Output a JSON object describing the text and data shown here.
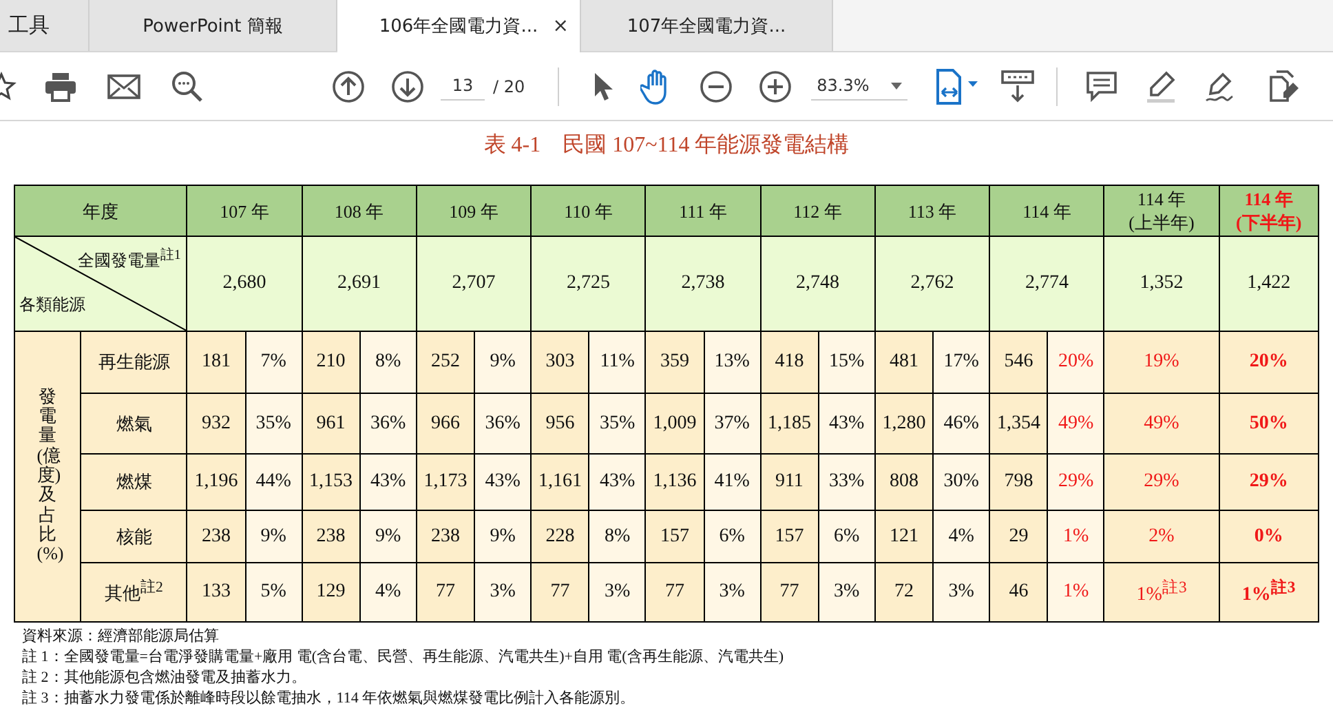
{
  "tabs": [
    {
      "label": "工具",
      "selected": false
    },
    {
      "label": "PowerPoint 簡報",
      "selected": false
    },
    {
      "label": "106年全國電力資...",
      "selected": true,
      "close": "×"
    },
    {
      "label": "107年全國電力資...",
      "selected": false
    }
  ],
  "toolbar": {
    "page": "13",
    "page_count": "/ 20",
    "zoom": "83.3%",
    "pointer_selected": false,
    "hand_selected": true
  },
  "document": {
    "title": "表 4-1　民國 107~114 年能源發電結構",
    "table": {
      "corner_header": "年度",
      "total_label": "全國發電量$^{註1}$",
      "category_label": "各類能源",
      "side_label": "發電量(億度)及占比(%)",
      "columns": [
        {
          "label": "107 年",
          "kind": "year",
          "header_red": false,
          "cells_red": false,
          "bold": false
        },
        {
          "label": "108 年",
          "kind": "year",
          "header_red": false,
          "cells_red": false,
          "bold": false
        },
        {
          "label": "109 年",
          "kind": "year",
          "header_red": false,
          "cells_red": false,
          "bold": false
        },
        {
          "label": "110 年",
          "kind": "year",
          "header_red": false,
          "cells_red": false,
          "bold": false
        },
        {
          "label": "111 年",
          "kind": "year",
          "header_red": false,
          "cells_red": false,
          "bold": false
        },
        {
          "label": "112 年",
          "kind": "year",
          "header_red": false,
          "cells_red": false,
          "bold": false
        },
        {
          "label": "113 年",
          "kind": "year",
          "header_red": false,
          "cells_red": false,
          "bold": false
        },
        {
          "label": "114 年",
          "kind": "year",
          "header_red": false,
          "cells_red": true,
          "bold": false
        },
        {
          "label": "114 年",
          "sublabel": "(上半年)",
          "kind": "half",
          "header_red": false,
          "cells_red": true,
          "bold": false
        },
        {
          "label": "114 年",
          "sublabel": "(下半年)",
          "kind": "half",
          "header_red": true,
          "cells_red": true,
          "bold": true
        }
      ],
      "totals": [
        "2,680",
        "2,691",
        "2,707",
        "2,725",
        "2,738",
        "2,748",
        "2,762",
        "2,774",
        "1,352",
        "1,422"
      ],
      "rows": [
        {
          "name": "再生能源",
          "cells": [
            {
              "value": "181",
              "share": "7%"
            },
            {
              "value": "210",
              "share": "8%"
            },
            {
              "value": "252",
              "share": "9%"
            },
            {
              "value": "303",
              "share": "11%"
            },
            {
              "value": "359",
              "share": "13%"
            },
            {
              "value": "418",
              "share": "15%"
            },
            {
              "value": "481",
              "share": "17%"
            },
            {
              "value": "546",
              "share": "20%"
            },
            {
              "share": "19%"
            },
            {
              "share": "20%"
            }
          ]
        },
        {
          "name": "燃氣",
          "cells": [
            {
              "value": "932",
              "share": "35%"
            },
            {
              "value": "961",
              "share": "36%"
            },
            {
              "value": "966",
              "share": "36%"
            },
            {
              "value": "956",
              "share": "35%"
            },
            {
              "value": "1,009",
              "share": "37%"
            },
            {
              "value": "1,185",
              "share": "43%"
            },
            {
              "value": "1,280",
              "share": "46%"
            },
            {
              "value": "1,354",
              "share": "49%"
            },
            {
              "share": "49%"
            },
            {
              "share": "50%"
            }
          ]
        },
        {
          "name": "燃煤",
          "cells": [
            {
              "value": "1,196",
              "share": "44%"
            },
            {
              "value": "1,153",
              "share": "43%"
            },
            {
              "value": "1,173",
              "share": "43%"
            },
            {
              "value": "1,161",
              "share": "43%"
            },
            {
              "value": "1,136",
              "share": "41%"
            },
            {
              "value": "911",
              "share": "33%"
            },
            {
              "value": "808",
              "share": "30%"
            },
            {
              "value": "798",
              "share": "29%"
            },
            {
              "share": "29%"
            },
            {
              "share": "29%"
            }
          ]
        },
        {
          "name": "核能",
          "cells": [
            {
              "value": "238",
              "share": "9%"
            },
            {
              "value": "238",
              "share": "9%"
            },
            {
              "value": "238",
              "share": "9%"
            },
            {
              "value": "228",
              "share": "8%"
            },
            {
              "value": "157",
              "share": "6%"
            },
            {
              "value": "157",
              "share": "6%"
            },
            {
              "value": "121",
              "share": "4%"
            },
            {
              "value": "29",
              "share": "1%"
            },
            {
              "share": "2%"
            },
            {
              "share": "0%"
            }
          ]
        },
        {
          "name": "其他$^{註2}$",
          "cells": [
            {
              "value": "133",
              "share": "5%"
            },
            {
              "value": "129",
              "share": "4%"
            },
            {
              "value": "77",
              "share": "3%"
            },
            {
              "value": "77",
              "share": "3%"
            },
            {
              "value": "77",
              "share": "3%"
            },
            {
              "value": "77",
              "share": "3%"
            },
            {
              "value": "72",
              "share": "3%"
            },
            {
              "value": "46",
              "share": "1%"
            },
            {
              "share": "1%$^{註3}$"
            },
            {
              "share": "1%$^{註3}$"
            }
          ]
        }
      ]
    },
    "notes": [
      "資料來源：經濟部能源局估算",
      "註 1：全國發電量=台電淨發購電量+廠用 電(含台電、民營、再生能源、汽電共生)+自用 電(含再生能源、汽電共生)",
      "註 2：其他能源包含燃油發電及抽蓄水力。",
      "註 3：抽蓄水力發電係於離峰時段以餘電抽水，114 年依燃氣與燃煤發電比例計入各能源別。"
    ]
  }
}
